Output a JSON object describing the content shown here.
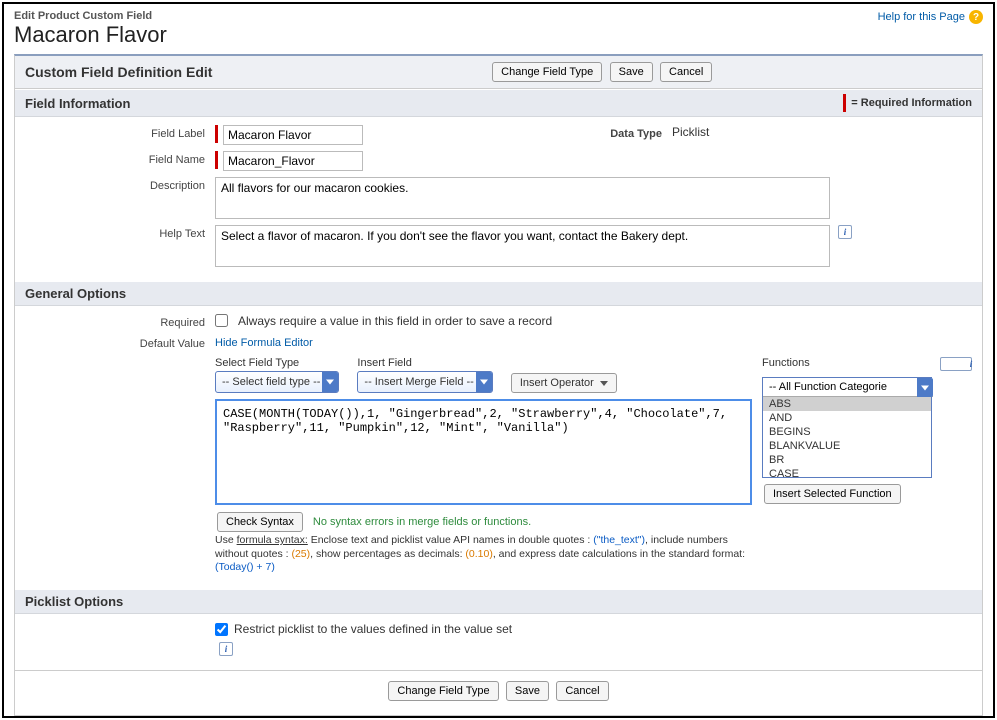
{
  "header": {
    "breadcrumb": "Edit Product Custom Field",
    "title": "Macaron Flavor",
    "help_link": "Help for this Page"
  },
  "pb": {
    "title": "Custom Field Definition Edit",
    "change_type_btn": "Change Field Type",
    "save_btn": "Save",
    "cancel_btn": "Cancel"
  },
  "field_info": {
    "section_title": "Field Information",
    "required_legend": "= Required Information",
    "labels": {
      "field_label": "Field Label",
      "field_name": "Field Name",
      "description": "Description",
      "help_text": "Help Text",
      "data_type": "Data Type"
    },
    "values": {
      "field_label": "Macaron Flavor",
      "field_name": "Macaron_Flavor",
      "description": "All flavors for our macaron cookies.",
      "help_text": "Select a flavor of macaron. If you don't see the flavor you want, contact the Bakery dept.",
      "data_type": "Picklist"
    }
  },
  "general": {
    "section_title": "General Options",
    "labels": {
      "required": "Required",
      "default_value": "Default Value"
    },
    "required_checkbox": "Always require a value in this field in order to save a record",
    "hide_formula_link": "Hide Formula Editor",
    "select_field_type_label": "Select Field Type",
    "select_field_type_value": "-- Select field type --",
    "insert_field_label": "Insert Field",
    "insert_field_value": "-- Insert Merge Field --",
    "insert_operator_btn": "Insert Operator",
    "functions_label": "Functions",
    "functions_category": "-- All Function Categorie",
    "functions_list": [
      "ABS",
      "AND",
      "BEGINS",
      "BLANKVALUE",
      "BR",
      "CASE"
    ],
    "insert_selected_fn_btn": "Insert Selected Function",
    "formula": "CASE(MONTH(TODAY()),1, \"Gingerbread\",2, \"Strawberry\",4, \"Chocolate\",7, \"Raspberry\",11, \"Pumpkin\",12, \"Mint\", \"Vanilla\")",
    "check_syntax_btn": "Check Syntax",
    "syntax_msg": "No syntax errors in merge fields or functions.",
    "hint_prefix": "Use ",
    "hint_underline": "formula syntax:",
    "hint_body": " Enclose text and picklist value API names in double quotes : ",
    "hint_ex1": "(\"the_text\")",
    "hint_body2": ", include numbers without quotes : ",
    "hint_ex2": "(25)",
    "hint_body3": ", show percentages as decimals: ",
    "hint_ex3": "(0.10)",
    "hint_body4": ", and express date calculations in the standard format: ",
    "hint_ex4": "(Today() + 7)"
  },
  "picklist": {
    "section_title": "Picklist Options",
    "restrict_checkbox": "Restrict picklist to the values defined in the value set"
  }
}
